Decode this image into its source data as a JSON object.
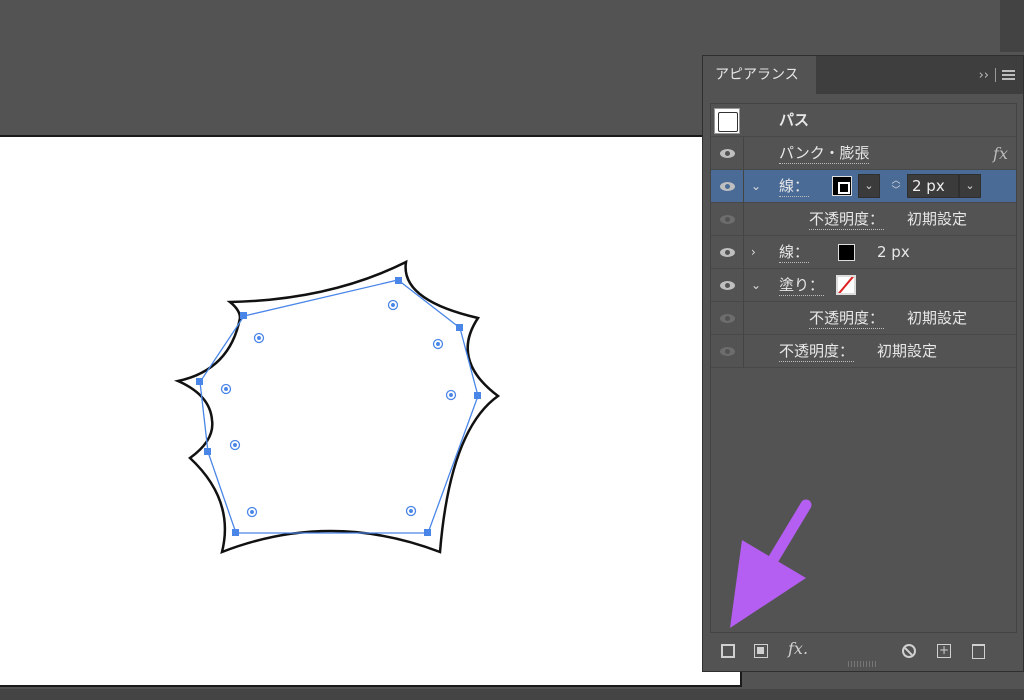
{
  "panel": {
    "tab_label": "アピアランス",
    "collapse_glyph": "››",
    "menu_icon": "panel-menu-icon"
  },
  "rows": {
    "path_label": "パス",
    "effect_label": "パンク・膨張",
    "effect_fx": "fx",
    "stroke1_label": "線：",
    "stroke1_value": "2 px",
    "opacity1_label": "不透明度：",
    "opacity1_value": "初期設定",
    "stroke2_label": "線：",
    "stroke2_value": "2 px",
    "fill_label": "塗り：",
    "opacity2_label": "不透明度：",
    "opacity2_value": "初期設定",
    "opacity3_label": "不透明度：",
    "opacity3_value": "初期設定"
  },
  "footer": {
    "fx_label": "fx."
  },
  "colors": {
    "selection": "#4b6b97",
    "annotation_arrow": "#b45ef2",
    "path_outline": "#4a86e8"
  }
}
